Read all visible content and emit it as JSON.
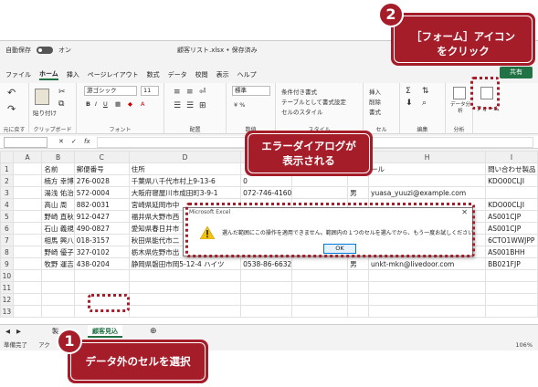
{
  "titlebar": {
    "autosave": "自動保存",
    "autosave_state": "オン",
    "filename": "顧客リスト.xlsx • 保存済み"
  },
  "menu": [
    "ファイル",
    "ホーム",
    "挿入",
    "ページレイアウト",
    "数式",
    "データ",
    "校閲",
    "表示",
    "ヘルプ"
  ],
  "share_label": "共有",
  "ribbon": {
    "clipboard_label": "クリップボード",
    "undo_label": "元に戻す",
    "paste_label": "貼り付け",
    "font_name": "游ゴシック",
    "font_size": "11",
    "font_label": "フォント",
    "align_label": "配置",
    "number_format": "標準",
    "number_label": "数値",
    "cond_format": "条件付き書式",
    "table_format": "テーブルとして書式設定",
    "cell_style": "セルのスタイル",
    "style_label": "スタイル",
    "insert_label": "挿入",
    "delete_label": "削除",
    "format_label": "書式",
    "cell_label": "セル",
    "edit_label": "編集",
    "analyze_data": "データ分析",
    "analyze_label": "分析",
    "form_label": "フォーム"
  },
  "formula_bar": {
    "fx": "fx"
  },
  "columns": [
    "A",
    "B",
    "C",
    "D",
    "E",
    "F",
    "G",
    "H",
    "I"
  ],
  "rows": [
    {
      "n": "1",
      "b": "名前",
      "c": "郵便番号",
      "d": "住所",
      "e": "",
      "f": "",
      "g": "",
      "h": "ール",
      "i": "問い合わせ製品"
    },
    {
      "n": "2",
      "b": "楠方 幸博",
      "c": "276-0028",
      "d": "千葉県八千代市村上9-13-6",
      "e": "0",
      "f": "",
      "g": "",
      "h": "",
      "i": "KDO00CLJI"
    },
    {
      "n": "3",
      "b": "湯浅 佑治",
      "c": "572-0004",
      "d": "大阪府寝屋川市成田町3-9-1",
      "e": "072-746-4160",
      "f": "",
      "g": "男",
      "h": "yuasa_yuuzi@example.com",
      "i": ""
    },
    {
      "n": "4",
      "b": "高山 周",
      "c": "882-0031",
      "d": "宮崎県延岡市中",
      "e": "",
      "f": "",
      "g": "",
      "h": "",
      "i": "KDO00CLJI"
    },
    {
      "n": "5",
      "b": "野崎 直秋",
      "c": "912-0427",
      "d": "福井県大野市西",
      "e": "",
      "f": "",
      "g": "",
      "h": "",
      "i": "AS001CJP"
    },
    {
      "n": "6",
      "b": "石山 義規",
      "c": "490-0827",
      "d": "愛知県春日井市",
      "e": "",
      "f": "",
      "g": "",
      "h": "",
      "i": "AS001CJP"
    },
    {
      "n": "7",
      "b": "相馬 興八",
      "c": "018-3157",
      "d": "秋田県能代市二",
      "e": "",
      "f": "",
      "g": "",
      "h": "el",
      "i": "6CTO1WWJPP"
    },
    {
      "n": "8",
      "b": "野崎 優子",
      "c": "327-0102",
      "d": "栃木県佐野市出",
      "e": "",
      "f": "",
      "g": "",
      "h": "",
      "i": "AS001BHH"
    },
    {
      "n": "9",
      "b": "牧野 運吉",
      "c": "438-0204",
      "d": "静岡県磐田市岡5-12-4 ハイツ",
      "e": "0538-86-6632",
      "f": "",
      "g": "男",
      "h": "unkt-mkn@livedoor.com",
      "i": "BB021FJP"
    },
    {
      "n": "10",
      "b": "",
      "c": "",
      "d": "",
      "e": "",
      "f": "",
      "g": "",
      "h": "",
      "i": ""
    },
    {
      "n": "11",
      "b": "",
      "c": "",
      "d": "",
      "e": "",
      "f": "",
      "g": "",
      "h": "",
      "i": ""
    },
    {
      "n": "12",
      "b": "",
      "c": "",
      "d": "",
      "e": "",
      "f": "",
      "g": "",
      "h": "",
      "i": ""
    },
    {
      "n": "13",
      "b": "",
      "c": "",
      "d": "",
      "e": "",
      "f": "",
      "g": "",
      "h": "",
      "i": ""
    }
  ],
  "sheet_tabs": {
    "first": "製",
    "active": "顧客見込"
  },
  "status": {
    "ready": "準備完了",
    "accessibility": "アク",
    "zoom": "106%"
  },
  "dialog": {
    "title": "Microsoft Excel",
    "message": "選んだ範囲にこの操作を適用できません。範囲内の１つのセルを選んでから、もう一度お試しください。",
    "ok": "OK"
  },
  "callouts": {
    "c1_num": "1",
    "c1_text": "データ外のセルを選択",
    "c2_num": "2",
    "c2_line1": "［フォーム］アイコン",
    "c2_line2": "をクリック",
    "c3_line1": "エラーダイアログが",
    "c3_line2": "表示される"
  },
  "colors": {
    "callout": "#a61d2a",
    "excel_green": "#217346"
  }
}
